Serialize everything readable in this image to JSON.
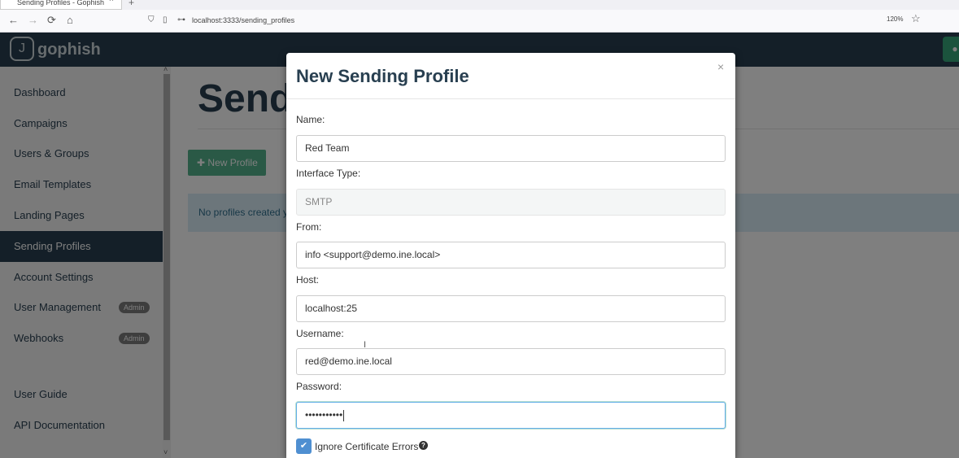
{
  "browser": {
    "tab_title": "Sending Profiles - Gophish",
    "tab_close": "×",
    "new_tab": "+",
    "back": "←",
    "forward": "→",
    "reload": "⟳",
    "home": "⌂",
    "url": "localhost:3333/sending_profiles",
    "zoom": "120%",
    "bookmark_icon": "star-icon"
  },
  "app": {
    "brand": "gophish",
    "logo_glyph": "J",
    "accent_color": "#37a67a",
    "header_color": "#283f50"
  },
  "sidebar": {
    "items": [
      {
        "label": "Dashboard"
      },
      {
        "label": "Campaigns"
      },
      {
        "label": "Users & Groups"
      },
      {
        "label": "Email Templates"
      },
      {
        "label": "Landing Pages"
      },
      {
        "label": "Sending Profiles",
        "active": true
      },
      {
        "label": "Account Settings"
      },
      {
        "label": "User Management",
        "badge": "Admin"
      },
      {
        "label": "Webhooks",
        "badge": "Admin"
      },
      {
        "label": "User Guide"
      },
      {
        "label": "API Documentation"
      }
    ]
  },
  "main": {
    "title": "Sending Profiles",
    "new_profile_button": "New Profile",
    "new_profile_icon": "plus-icon",
    "empty_alert": "No profiles created yet. Let's create one!"
  },
  "modal": {
    "title": "New Sending Profile",
    "close": "×",
    "fields": {
      "name": {
        "label": "Name:",
        "value": "Red Team"
      },
      "interface_type": {
        "label": "Interface Type:",
        "value": "SMTP"
      },
      "from": {
        "label": "From:",
        "value": "info <support@demo.ine.local>"
      },
      "host": {
        "label": "Host:",
        "value": "localhost:25"
      },
      "username": {
        "label": "Username:",
        "value": "red@demo.ine.local"
      },
      "password": {
        "label": "Password:",
        "value": "•••••••••••"
      }
    },
    "ignore_cert": {
      "label": "Ignore Certificate Errors",
      "checked": true,
      "help": "?"
    }
  }
}
